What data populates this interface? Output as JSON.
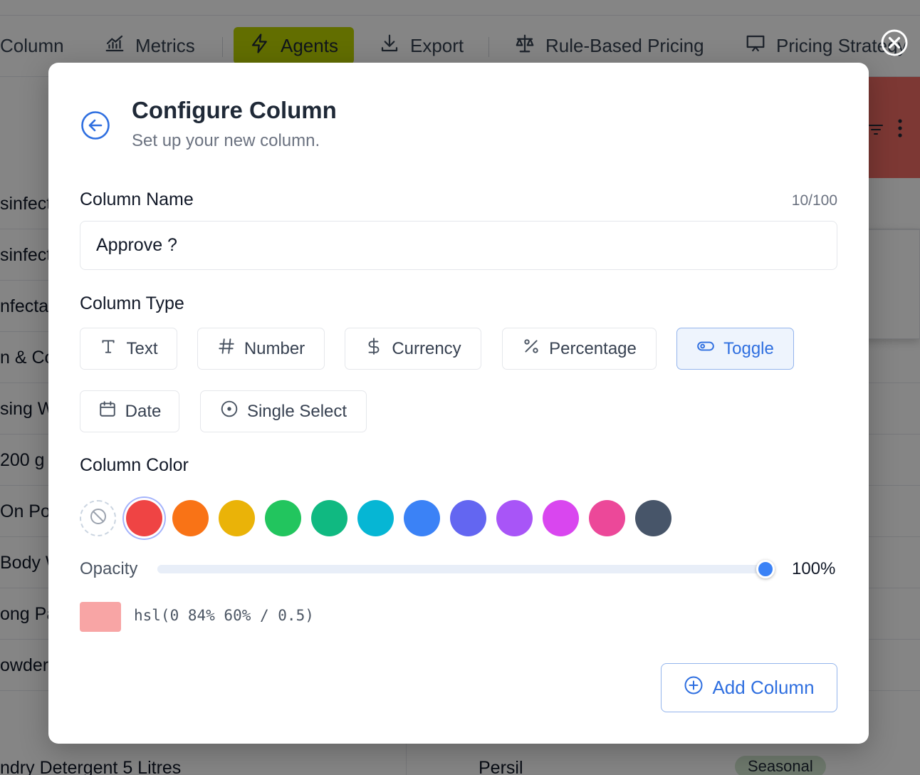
{
  "background": {
    "toolbar": {
      "items": [
        {
          "label": "Column",
          "icon": "columns-icon"
        },
        {
          "label": "Metrics",
          "icon": "chart-icon"
        },
        {
          "label": "Agents",
          "icon": "lightning-icon"
        },
        {
          "label": "Export",
          "icon": "download-icon"
        },
        {
          "label": "Rule-Based Pricing",
          "icon": "scale-icon"
        },
        {
          "label": "Pricing Strategy",
          "icon": "presentation-icon"
        }
      ]
    },
    "rows": [
      "sinfect",
      "sinfect",
      "nfecta",
      "n & Co",
      "sing W",
      "200 g",
      "On Po",
      "Body W",
      "ong Pa",
      "owder"
    ],
    "bottom_row": {
      "product": "ndry Detergent 5 Litres",
      "brand": "Persil",
      "tag": "Seasonal"
    },
    "colors": {
      "agents": "#bcd400",
      "header_red": "#ef6b64"
    }
  },
  "dialog": {
    "title": "Configure Column",
    "subtitle": "Set up your new column.",
    "column_name": {
      "label": "Column Name",
      "value": "Approve ?",
      "counter": "10/100"
    },
    "column_type": {
      "label": "Column Type",
      "options": [
        {
          "label": "Text",
          "icon": "text-icon"
        },
        {
          "label": "Number",
          "icon": "hash-icon"
        },
        {
          "label": "Currency",
          "icon": "dollar-icon"
        },
        {
          "label": "Percentage",
          "icon": "percent-icon"
        },
        {
          "label": "Toggle",
          "icon": "toggle-icon"
        },
        {
          "label": "Date",
          "icon": "calendar-icon"
        },
        {
          "label": "Single Select",
          "icon": "circle-dot-icon"
        }
      ],
      "selected": "Toggle"
    },
    "column_color": {
      "label": "Column Color",
      "swatches": [
        "none",
        "#ef4444",
        "#f97316",
        "#eab308",
        "#22c55e",
        "#10b981",
        "#06b6d4",
        "#3b82f6",
        "#6366f1",
        "#a855f7",
        "#d946ef",
        "#ec4899",
        "#475569"
      ],
      "selected_index": 1
    },
    "opacity": {
      "label": "Opacity",
      "value_text": "100%",
      "value": 1.0
    },
    "preview": {
      "color": "#f8a5a5",
      "text": "hsl(0 84% 60% / 0.5)"
    },
    "add_button": "Add Column",
    "accent": "#2f6fe0"
  }
}
